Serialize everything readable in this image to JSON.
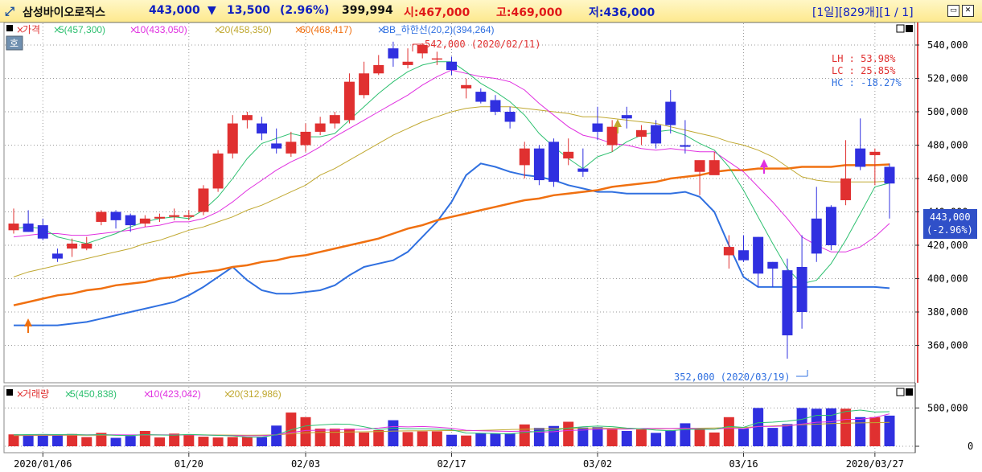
{
  "header": {
    "stock_name": "삼성바이오로직스",
    "price": "443,000",
    "change_arrow": "▼",
    "change": "13,500",
    "change_pct": "(2.96%)",
    "volume": "399,994",
    "open": "시:467,000",
    "high": "고:469,000",
    "low": "저:436,000",
    "period": "[1일][829개][1 / 1]"
  },
  "colors": {
    "up": "#e03030",
    "down": "#3030e0",
    "ma5": "#2ec070",
    "ma10": "#e030e0",
    "ma20": "#c0a830",
    "ma60": "#f07010",
    "bb": "#3070e0",
    "accent_title": "#1020c0"
  },
  "legend_price": {
    "price": "가격",
    "ma5": "5(457,300)",
    "ma10": "10(433,050)",
    "ma20": "20(458,350)",
    "ma60": "60(468,417)",
    "bb": "BB_하한선(20,2)(394,264)"
  },
  "legend_volume": {
    "vol": "거래량",
    "ma5": "5(450,838)",
    "ma10": "10(423,042)",
    "ma20": "20(312,986)"
  },
  "hoga_label": "호",
  "stats": {
    "lh": "LH :  53.98%",
    "lc": "LC :  25.85%",
    "hc": "HC : -18.27%"
  },
  "annotations": {
    "max": "542,000 (2020/02/11)",
    "min": "352,000 (2020/03/19)",
    "current_price": "443,000",
    "current_change": "(-2.96%)"
  },
  "chart_data": {
    "type": "candlestick",
    "dates": [
      "2020/01/02",
      "2020/01/03",
      "2020/01/06",
      "2020/01/07",
      "2020/01/08",
      "2020/01/09",
      "2020/01/10",
      "2020/01/13",
      "2020/01/14",
      "2020/01/15",
      "2020/01/16",
      "2020/01/17",
      "2020/01/20",
      "2020/01/21",
      "2020/01/22",
      "2020/01/23",
      "2020/01/28",
      "2020/01/29",
      "2020/01/30",
      "2020/01/31",
      "2020/02/03",
      "2020/02/04",
      "2020/02/05",
      "2020/02/06",
      "2020/02/07",
      "2020/02/10",
      "2020/02/11",
      "2020/02/12",
      "2020/02/13",
      "2020/02/14",
      "2020/02/17",
      "2020/02/18",
      "2020/02/19",
      "2020/02/20",
      "2020/02/21",
      "2020/02/24",
      "2020/02/25",
      "2020/02/26",
      "2020/02/27",
      "2020/02/28",
      "2020/03/02",
      "2020/03/03",
      "2020/03/04",
      "2020/03/05",
      "2020/03/06",
      "2020/03/09",
      "2020/03/10",
      "2020/03/11",
      "2020/03/12",
      "2020/03/13",
      "2020/03/16",
      "2020/03/17",
      "2020/03/18",
      "2020/03/19",
      "2020/03/20",
      "2020/03/23",
      "2020/03/24",
      "2020/03/25",
      "2020/03/26",
      "2020/03/27",
      "2020/03/30"
    ],
    "open": [
      429000,
      433000,
      432000,
      415000,
      418000,
      418000,
      434000,
      440000,
      438000,
      433000,
      436000,
      437000,
      437000,
      440000,
      454000,
      475000,
      495000,
      493000,
      481000,
      475000,
      480000,
      488000,
      493000,
      495000,
      510000,
      523000,
      538000,
      528000,
      535000,
      532000,
      530000,
      514000,
      512000,
      507000,
      500000,
      468000,
      478000,
      482000,
      472000,
      466000,
      493000,
      480000,
      498000,
      485000,
      492000,
      506000,
      480000,
      464000,
      462000,
      414000,
      417000,
      425000,
      410000,
      405000,
      407000,
      436000,
      443000,
      447000,
      478000,
      474000,
      467000
    ],
    "close": [
      433000,
      428000,
      424000,
      412000,
      421000,
      421000,
      440000,
      435000,
      432000,
      436000,
      437000,
      438000,
      438000,
      454000,
      475000,
      493000,
      498000,
      487000,
      478000,
      482000,
      488000,
      493000,
      498000,
      518000,
      523000,
      528000,
      532000,
      530000,
      540000,
      532000,
      525000,
      516000,
      506000,
      500000,
      494000,
      478000,
      459000,
      458000,
      476000,
      464000,
      488000,
      491000,
      496000,
      489000,
      481000,
      492000,
      479000,
      471000,
      471000,
      419000,
      411000,
      403000,
      406000,
      366000,
      380000,
      415000,
      420000,
      460000,
      467000,
      476000,
      457000
    ],
    "high": [
      442000,
      441000,
      436000,
      418000,
      424000,
      425000,
      441000,
      441000,
      439000,
      438000,
      439000,
      442000,
      441000,
      456000,
      477000,
      498000,
      500000,
      497000,
      490000,
      488000,
      493000,
      497000,
      500000,
      523000,
      530000,
      534000,
      542000,
      538000,
      541000,
      536000,
      533000,
      520000,
      514000,
      510000,
      503000,
      482000,
      480000,
      484000,
      484000,
      478000,
      503000,
      495000,
      503000,
      492000,
      495000,
      513000,
      495000,
      470000,
      476000,
      426000,
      426000,
      425000,
      410000,
      412000,
      426000,
      455000,
      444000,
      483000,
      496000,
      478000,
      469000
    ],
    "low": [
      427000,
      428000,
      423000,
      410000,
      413000,
      417000,
      432000,
      430000,
      428000,
      431000,
      434000,
      435000,
      435000,
      438000,
      452000,
      472000,
      490000,
      483000,
      475000,
      473000,
      476000,
      486000,
      490000,
      493000,
      508000,
      522000,
      527000,
      526000,
      532000,
      528000,
      522000,
      508000,
      505000,
      498000,
      490000,
      460000,
      456000,
      455000,
      468000,
      461000,
      483000,
      476000,
      490000,
      480000,
      478000,
      487000,
      475000,
      450000,
      463000,
      406000,
      410000,
      395000,
      395000,
      352000,
      370000,
      410000,
      417000,
      444000,
      465000,
      456000,
      436000
    ],
    "ma5": [
      430000,
      431000,
      430000,
      425000,
      423000,
      421000,
      424000,
      427000,
      431000,
      434000,
      436000,
      437000,
      436000,
      441000,
      449000,
      460000,
      472000,
      481000,
      484000,
      487000,
      485000,
      485000,
      487000,
      495000,
      503000,
      511000,
      518000,
      524000,
      528000,
      530000,
      530000,
      524000,
      517000,
      512000,
      506000,
      498000,
      487000,
      479000,
      472000,
      466000,
      473000,
      476000,
      482000,
      486000,
      488000,
      489000,
      486000,
      481000,
      477000,
      467000,
      453000,
      437000,
      421000,
      406000,
      397000,
      399000,
      409000,
      423000,
      439000,
      455000,
      457300
    ],
    "ma10": [
      425000,
      426000,
      427000,
      427000,
      426000,
      426000,
      427000,
      428000,
      429000,
      431000,
      432000,
      434000,
      434000,
      436000,
      440000,
      446000,
      453000,
      459000,
      465000,
      470000,
      474000,
      479000,
      485000,
      490000,
      495000,
      500000,
      505000,
      510000,
      516000,
      521000,
      525000,
      523000,
      521000,
      520000,
      518000,
      513000,
      505000,
      498000,
      491000,
      486000,
      484000,
      481000,
      480000,
      478000,
      477000,
      478000,
      477000,
      476000,
      476000,
      470000,
      464000,
      455000,
      446000,
      436000,
      425000,
      420000,
      416000,
      416000,
      419000,
      425000,
      433050
    ],
    "ma20": [
      401000,
      404000,
      406000,
      408000,
      410000,
      412000,
      414000,
      416000,
      418000,
      421000,
      423000,
      426000,
      429000,
      431000,
      434000,
      437000,
      441000,
      444000,
      448000,
      452000,
      456000,
      462000,
      466000,
      471000,
      476000,
      481000,
      486000,
      490000,
      494000,
      497000,
      500000,
      502000,
      503000,
      503000,
      503000,
      502000,
      501000,
      500000,
      499000,
      497000,
      497000,
      496000,
      495000,
      494000,
      493000,
      491000,
      489000,
      487000,
      485000,
      482000,
      480000,
      477000,
      473000,
      467000,
      461000,
      459000,
      458000,
      458000,
      458000,
      458000,
      458350
    ],
    "ma60": [
      384000,
      386000,
      388000,
      390000,
      391000,
      393000,
      394000,
      396000,
      397000,
      398000,
      400000,
      401000,
      403000,
      404000,
      405000,
      407000,
      408000,
      410000,
      411000,
      413000,
      414000,
      416000,
      418000,
      420000,
      422000,
      424000,
      427000,
      430000,
      432000,
      435000,
      437000,
      439000,
      441000,
      443000,
      445000,
      447000,
      448000,
      450000,
      451000,
      452000,
      453000,
      455000,
      456000,
      457000,
      458000,
      460000,
      461000,
      462000,
      464000,
      465000,
      465000,
      466000,
      466000,
      466000,
      467000,
      467000,
      467000,
      468000,
      468000,
      468000,
      468417
    ],
    "bb_lower": [
      372000,
      372000,
      372000,
      372000,
      373000,
      374000,
      376000,
      378000,
      380000,
      382000,
      384000,
      386000,
      390000,
      395000,
      401000,
      407000,
      399000,
      393000,
      391000,
      391000,
      392000,
      393000,
      396000,
      402000,
      407000,
      409000,
      411000,
      416000,
      425000,
      434000,
      446000,
      462000,
      469000,
      467000,
      464000,
      462000,
      461000,
      459000,
      456000,
      454000,
      452000,
      452000,
      451000,
      451000,
      451000,
      451000,
      452000,
      449000,
      440000,
      420000,
      401000,
      395000,
      395000,
      395000,
      395000,
      395000,
      395000,
      395000,
      395000,
      395000,
      394264
    ],
    "volume": [
      155000,
      150000,
      155000,
      150000,
      160000,
      120000,
      175000,
      110000,
      135000,
      200000,
      115000,
      165000,
      155000,
      125000,
      115000,
      120000,
      120000,
      120000,
      270000,
      440000,
      380000,
      230000,
      230000,
      230000,
      180000,
      210000,
      340000,
      185000,
      195000,
      195000,
      150000,
      140000,
      170000,
      165000,
      170000,
      285000,
      240000,
      265000,
      320000,
      245000,
      250000,
      220000,
      200000,
      220000,
      175000,
      210000,
      300000,
      225000,
      180000,
      380000,
      230000,
      500000,
      240000,
      290000,
      500000,
      490000,
      495000,
      490000,
      380000,
      380000,
      399994
    ],
    "vol_ma5": [
      150000,
      152000,
      154000,
      152000,
      154000,
      147000,
      152000,
      143000,
      140000,
      152000,
      147000,
      145000,
      154000,
      148000,
      142000,
      136000,
      120000,
      120000,
      150000,
      214000,
      266000,
      278000,
      290000,
      288000,
      254000,
      216000,
      238000,
      229000,
      228000,
      225000,
      215000,
      173000,
      170000,
      167000,
      162000,
      180000,
      195000,
      209000,
      237000,
      255000,
      263000,
      256000,
      237000,
      228000,
      211000,
      201000,
      219000,
      223000,
      221000,
      259000,
      247000,
      307000,
      315000,
      328000,
      352000,
      404000,
      403000,
      453000,
      472000,
      447000,
      450838
    ],
    "vol_ma10": [
      148000,
      149000,
      150000,
      150000,
      151000,
      150000,
      151000,
      149000,
      148000,
      149000,
      149000,
      148000,
      149000,
      146000,
      143000,
      141000,
      136000,
      137000,
      149000,
      178000,
      206000,
      210000,
      213000,
      219000,
      224000,
      237000,
      258000,
      253000,
      258000,
      250000,
      235000,
      209000,
      203000,
      198000,
      194000,
      198000,
      184000,
      190000,
      206000,
      211000,
      222000,
      225000,
      223000,
      232000,
      233000,
      232000,
      237000,
      229000,
      224000,
      236000,
      228000,
      258000,
      260000,
      266000,
      290000,
      314000,
      320000,
      351000,
      352000,
      377000,
      423042
    ],
    "vol_ma20": [
      140000,
      141000,
      142000,
      143000,
      144000,
      145000,
      145000,
      146000,
      146000,
      147000,
      147000,
      147000,
      148000,
      148000,
      147000,
      146000,
      145000,
      146000,
      150000,
      163000,
      175000,
      180000,
      183000,
      186000,
      189000,
      192000,
      198000,
      200000,
      203000,
      204000,
      205000,
      203000,
      208000,
      212000,
      218000,
      221000,
      227000,
      230000,
      233000,
      236000,
      240000,
      235000,
      233000,
      231000,
      229000,
      230000,
      232000,
      236000,
      238000,
      243000,
      245000,
      257000,
      265000,
      273000,
      281000,
      289000,
      296000,
      301000,
      305000,
      309000,
      312986
    ],
    "ylim": [
      340000,
      555000
    ],
    "y_ticks": [
      "540,000",
      "520,000",
      "500,000",
      "480,000",
      "460,000",
      "440,000",
      "420,000",
      "400,000",
      "380,000",
      "360,000"
    ],
    "vol_ticks": [
      "500,000",
      "0"
    ],
    "vol_ylim": [
      0,
      560000
    ],
    "x_tick_labels": [
      "2020/01/06",
      "01/20",
      "02/03",
      "02/17",
      "03/02",
      "03/16",
      "2020/03/27"
    ],
    "grid": true,
    "y_axis": "right"
  }
}
